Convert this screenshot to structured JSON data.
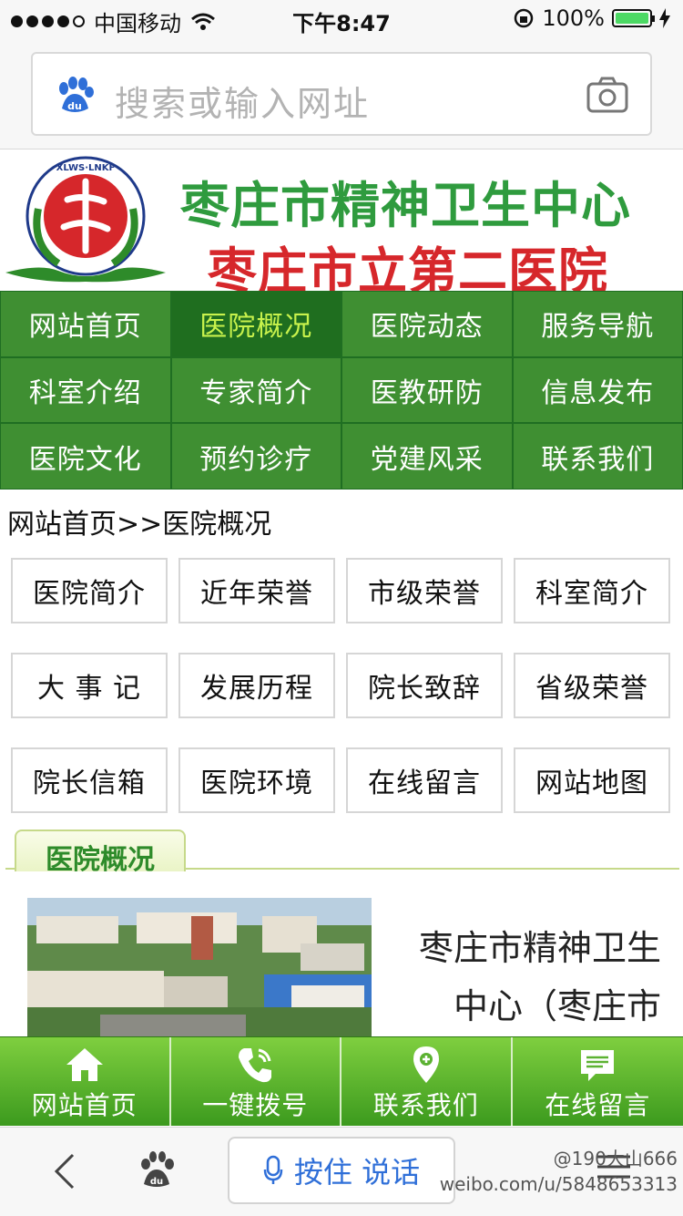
{
  "status_bar": {
    "carrier": "中国移动",
    "time": "下午8:47",
    "battery": "100%"
  },
  "browser": {
    "search_placeholder": "搜索或输入网址",
    "voice_button": "按住 说话"
  },
  "banner": {
    "title_line1": "枣庄市精神卫生中心",
    "title_line2": "枣庄市立第二医院",
    "logo_text": "XLWS·LNKF"
  },
  "nav": {
    "items": [
      {
        "label": "网站首页",
        "active": false
      },
      {
        "label": "医院概况",
        "active": true
      },
      {
        "label": "医院动态",
        "active": false
      },
      {
        "label": "服务导航",
        "active": false
      },
      {
        "label": "科室介绍",
        "active": false
      },
      {
        "label": "专家简介",
        "active": false
      },
      {
        "label": "医教研防",
        "active": false
      },
      {
        "label": "信息发布",
        "active": false
      },
      {
        "label": "医院文化",
        "active": false
      },
      {
        "label": "预约诊疗",
        "active": false
      },
      {
        "label": "党建风采",
        "active": false
      },
      {
        "label": "联系我们",
        "active": false
      }
    ]
  },
  "breadcrumb": "网站首页>>医院概况",
  "sub_menu": {
    "items": [
      "医院简介",
      "近年荣誉",
      "市级荣誉",
      "科室简介",
      "大 事 记",
      "发展历程",
      "院长致辞",
      "省级荣誉",
      "院长信箱",
      "医院环境",
      "在线留言",
      "网站地图"
    ]
  },
  "section": {
    "tab_label": "医院概况",
    "intro_text": "枣庄市精神卫生中心（枣庄市"
  },
  "bottom_bar": {
    "items": [
      {
        "label": "网站首页",
        "icon": "home-icon"
      },
      {
        "label": "一键拨号",
        "icon": "phone-icon"
      },
      {
        "label": "联系我们",
        "icon": "location-pin-icon"
      },
      {
        "label": "在线留言",
        "icon": "message-icon"
      }
    ]
  },
  "watermark": {
    "handle": "@190大山666",
    "url": "weibo.com/u/5848653313"
  },
  "colors": {
    "nav_green": "#3f8f32",
    "nav_active_text": "#c8f24c",
    "title_green": "#2f9b3e",
    "title_red": "#d6272b"
  }
}
